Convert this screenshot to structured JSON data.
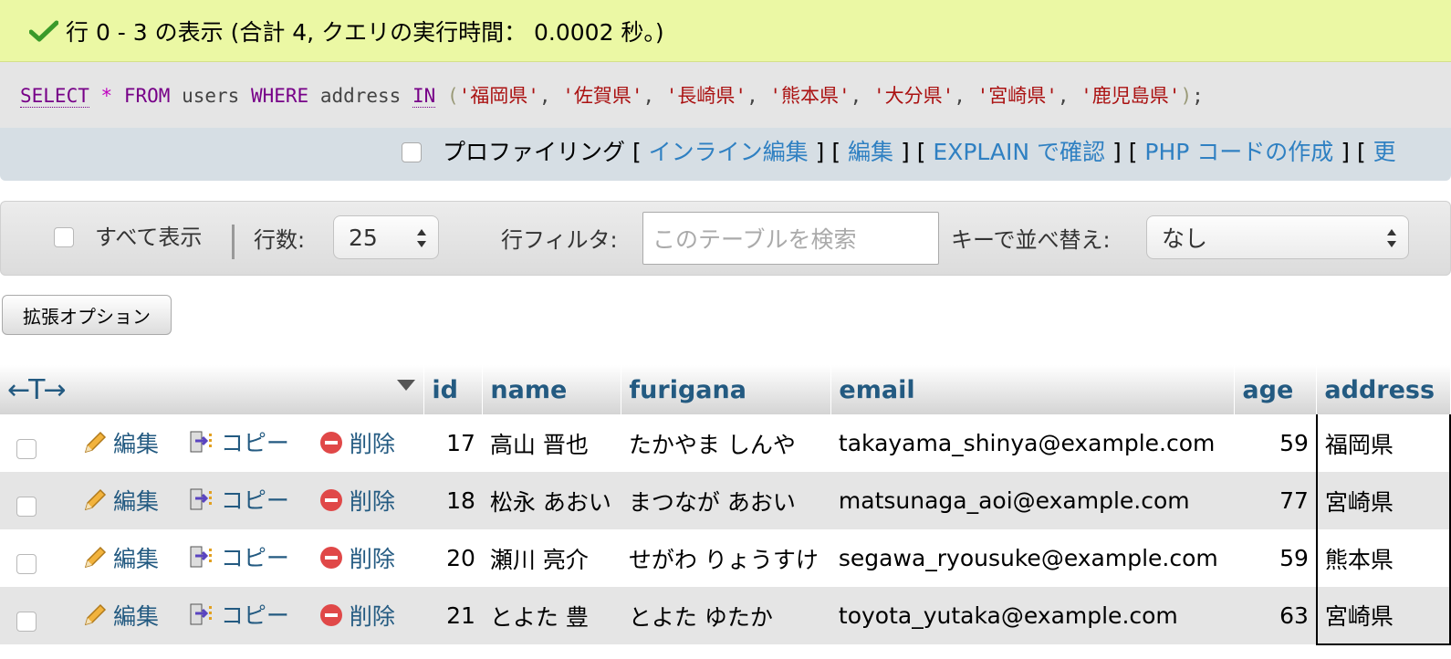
{
  "message": {
    "text": "行 0 - 3 の表示 (合計 4, クエリの実行時間： 0.0002 秒。)",
    "color": "#ebf8a4"
  },
  "sql": {
    "select": "SELECT",
    "star": "*",
    "from": "FROM",
    "table": "users",
    "where": "WHERE",
    "column": "address",
    "in": "IN",
    "values": [
      "'福岡県'",
      "'佐賀県'",
      "'長崎県'",
      "'熊本県'",
      "'大分県'",
      "'宮崎県'",
      "'鹿児島県'"
    ]
  },
  "profiling": {
    "label": "プロファイリング",
    "links": [
      "インライン編集",
      "編集",
      "EXPLAIN で確認",
      "PHP コードの作成",
      "更"
    ]
  },
  "navigation": {
    "show_all": "すべて表示",
    "rows_label": "行数:",
    "rows_value": "25",
    "filter_label": "行フィルタ:",
    "filter_placeholder": "このテーブルを検索",
    "sort_label": "キーで並べ替え:",
    "sort_value": "なし"
  },
  "extended_options": "拡張オプション",
  "table": {
    "columns": [
      "id",
      "name",
      "furigana",
      "email",
      "age",
      "address"
    ],
    "actions": {
      "edit": "編集",
      "copy": "コピー",
      "delete": "削除"
    },
    "rows": [
      {
        "id": "17",
        "name": "高山 晋也",
        "furigana": "たかやま しんや",
        "email": "takayama_shinya@example.com",
        "age": "59",
        "address": "福岡県"
      },
      {
        "id": "18",
        "name": "松永 あおい",
        "furigana": "まつなが あおい",
        "email": "matsunaga_aoi@example.com",
        "age": "77",
        "address": "宮崎県"
      },
      {
        "id": "20",
        "name": "瀬川 亮介",
        "furigana": "せがわ りょうすけ",
        "email": "segawa_ryousuke@example.com",
        "age": "59",
        "address": "熊本県"
      },
      {
        "id": "21",
        "name": "とよた 豊",
        "furigana": "とよた ゆたか",
        "email": "toyota_yutaka@example.com",
        "age": "63",
        "address": "宮崎県"
      }
    ]
  },
  "icons": {
    "success": "check-icon",
    "edit": "pencil-icon",
    "copy": "copy-icon",
    "delete": "delete-icon",
    "column_arrows": "column-arrows-icon",
    "sort": "sort-triangle-icon"
  },
  "colors": {
    "link": "#2f80c2",
    "header_text": "#235a81",
    "keyword": "#770088",
    "string": "#aa1111"
  }
}
